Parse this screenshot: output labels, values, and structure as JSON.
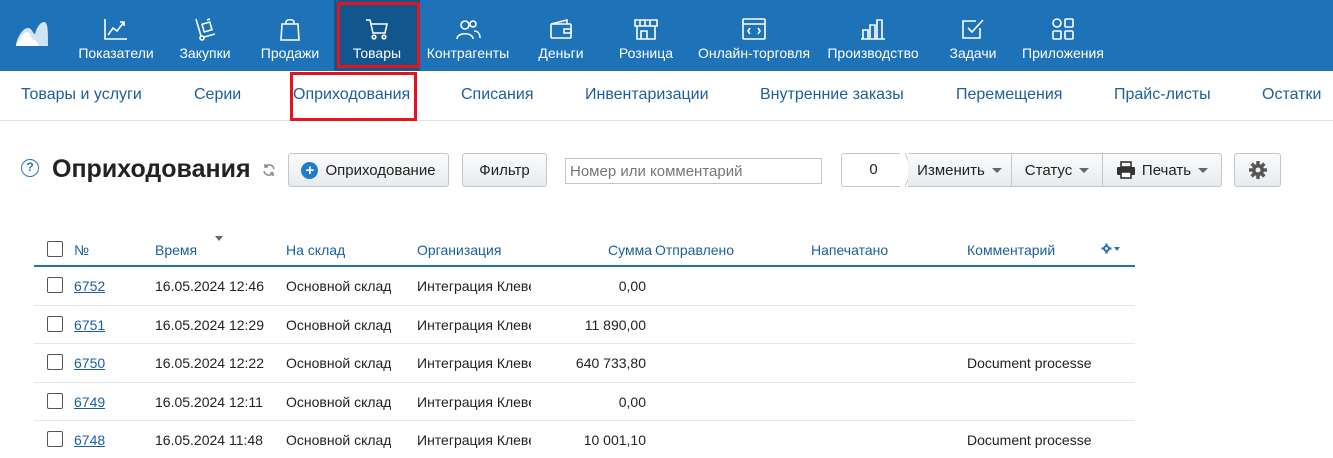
{
  "nav": {
    "items": [
      {
        "label": "Показатели",
        "icon": "chart-line-icon"
      },
      {
        "label": "Закупки",
        "icon": "cart-dolly-icon"
      },
      {
        "label": "Продажи",
        "icon": "shopping-bag-icon"
      },
      {
        "label": "Товары",
        "icon": "cart-icon"
      },
      {
        "label": "Контрагенты",
        "icon": "users-icon"
      },
      {
        "label": "Деньги",
        "icon": "wallet-icon"
      },
      {
        "label": "Розница",
        "icon": "store-icon"
      },
      {
        "label": "Онлайн-торговля",
        "icon": "online-store-icon"
      },
      {
        "label": "Производство",
        "icon": "factory-icon"
      },
      {
        "label": "Задачи",
        "icon": "checkbox-icon"
      },
      {
        "label": "Приложения",
        "icon": "apps-grid-icon"
      }
    ],
    "active": "Товары"
  },
  "subnav": {
    "items": [
      "Товары и услуги",
      "Серии",
      "Оприходования",
      "Списания",
      "Инвентаризации",
      "Внутренние заказы",
      "Перемещения",
      "Прайс-листы",
      "Остатки"
    ],
    "active": "Оприходования"
  },
  "toolbar": {
    "help": "?",
    "title": "Оприходования",
    "add_label": "Оприходование",
    "filter_label": "Фильтр",
    "search_placeholder": "Номер или комментарий",
    "selected_count": "0",
    "edit_label": "Изменить",
    "status_label": "Статус",
    "print_label": "Печать"
  },
  "table": {
    "columns": [
      "№",
      "Время",
      "На склад",
      "Организация",
      "Сумма",
      "Отправлено",
      "Напечатано",
      "Комментарий"
    ],
    "rows": [
      {
        "num": "6752",
        "time": "16.05.2024 12:46",
        "store": "Основной склад",
        "org": "Интеграция Клевер",
        "sum": "0,00",
        "comment": ""
      },
      {
        "num": "6751",
        "time": "16.05.2024 12:29",
        "store": "Основной склад",
        "org": "Интеграция Клевер",
        "sum": "11 890,00",
        "comment": ""
      },
      {
        "num": "6750",
        "time": "16.05.2024 12:22",
        "store": "Основной склад",
        "org": "Интеграция Клевер",
        "sum": "640 733,80",
        "comment": "Document processed"
      },
      {
        "num": "6749",
        "time": "16.05.2024 12:11",
        "store": "Основной склад",
        "org": "Интеграция Клевер",
        "sum": "0,00",
        "comment": ""
      },
      {
        "num": "6748",
        "time": "16.05.2024 11:48",
        "store": "Основной склад",
        "org": "Интеграция Клевер",
        "sum": "10 001,10",
        "comment": "Document processed"
      }
    ]
  },
  "colors": {
    "nav_bg": "#1e72b8",
    "nav_active_bg": "#12568e",
    "link": "#1d5f9a",
    "highlight": "#e3141b",
    "add_icon": "#1e7cc8"
  }
}
